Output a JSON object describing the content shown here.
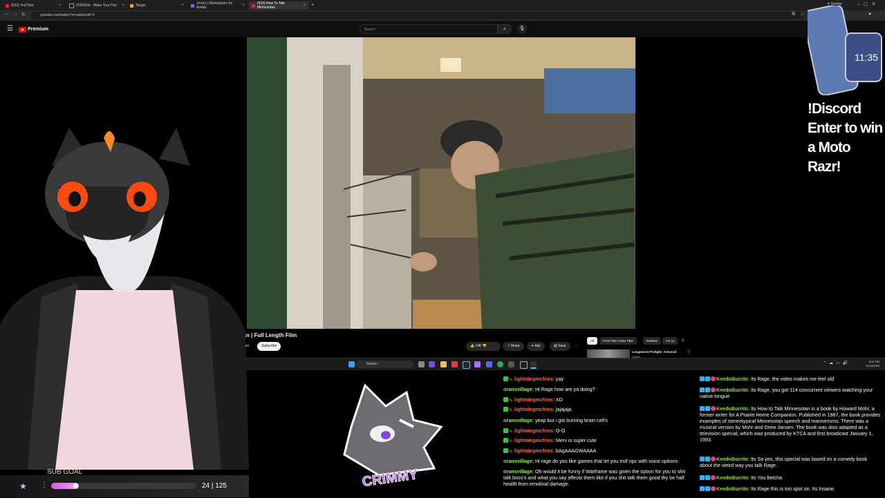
{
  "browser": {
    "tabs": [
      {
        "label": "(533) YouTube",
        "active": false
      },
      {
        "label": "(5354)ick - Make Your Day",
        "active": false
      },
      {
        "label": "Tangia",
        "active": false
      },
      {
        "label": "Jinxxy | Marketplace for Avatar",
        "active": false
      },
      {
        "label": "(533) How To Talk Minnesotan",
        "active": true
      }
    ],
    "new_tab": "+",
    "url": "youtube.com/watch?v=xuGeuvd4-0",
    "profile_label": "Gemini"
  },
  "youtube": {
    "brand": "Premium",
    "search_placeholder": "Search",
    "video_title": "esotan | Full Length Film",
    "join_label": "Join",
    "subscribe_label": "Subscribe",
    "like_count": "14K",
    "share_label": "Share",
    "ask_label": "Ask",
    "save_label": "Save",
    "more_label": "···",
    "chips": [
      "All",
      "From Twin Cities PBS",
      "Related",
      "For yo"
    ],
    "rec_title": "Longsword Profight: Armored",
    "rec_sub": "HEMA"
  },
  "taskbar": {
    "search_label": "Search",
    "time": "8:37 PM",
    "date": "12/16/2025"
  },
  "overlay": {
    "promo_lines": [
      "!Discord",
      "Enter to win",
      "a Moto Razr!"
    ],
    "phone_time": "11:35",
    "sub_goal_label": "SUB GOAL",
    "sub_goal_current": 24,
    "sub_goal_total": 125,
    "sub_goal_text": "24 | 125",
    "logo_text": "CRIMMY"
  },
  "chat_left": [
    {
      "user": "lightningmcfries",
      "color": "red",
      "badges": true,
      "text": "yay"
    },
    {
      "user": "oransvillage",
      "color": "green",
      "badges": false,
      "text": "Hi Rage how are ya doing?"
    },
    {
      "user": "lightningmcfries",
      "color": "red",
      "badges": true,
      "text": "XD"
    },
    {
      "user": "lightningmcfries",
      "color": "red",
      "badges": true,
      "text": "jajajaja"
    },
    {
      "user": "oransvillage",
      "color": "green",
      "badges": false,
      "text": "yeap but i got burning brain cell's"
    },
    {
      "user": "lightningmcfries",
      "color": "red",
      "badges": true,
      "text": "O-O"
    },
    {
      "user": "lightningmcfries",
      "color": "red",
      "badges": true,
      "text": "Merv is super cute"
    },
    {
      "user": "lightningmcfries",
      "color": "red",
      "badges": true,
      "text": "bAgAAAGWAAAA"
    },
    {
      "user": "oransvillage",
      "color": "green",
      "badges": false,
      "text": "Hi rage do you like games that let you troll npc with voice options"
    },
    {
      "user": "oransvillage",
      "color": "green",
      "badges": false,
      "text": "Oh would it be funny if Warframe was given the option for you to shit talk boss's and what you say affects them like if you shit talk them good thy be half health from emotinal damage."
    }
  ],
  "chat_right": [
    {
      "user": "KeedoBurrito",
      "text": "Its Rage, the video makes me feel old"
    },
    {
      "user": "KeedoBurrito",
      "text": "Its Rage, you got 114 concurrent viewers watching your native tongue"
    },
    {
      "user": "KeedoBurrito",
      "text": "Its How to Talk Minnesotan is a book by Howard Mohr, a former writer for A Prairie Home Companion. Published in 1987, the book provides examples of stereotypical Minnesotan speech and mannerisms. There was a musical version by Mohr and Drew Jansen. The book was also adapted as a television special, which was produced by KTCA and first broadcast January 1, 1993."
    },
    {
      "user": "KeedoBurrito",
      "text": "Its So yes, this special was based on a comedy book about the weird way you talk Rage."
    },
    {
      "user": "KeedoBurrito",
      "text": "Its You betcha"
    },
    {
      "user": "KeedoBurrito",
      "text": "Its Rage this is too spot on. Its Insane."
    }
  ],
  "colors": {
    "yt_red": "#ff0000",
    "chat_green": "#9be36b",
    "chat_red": "#ff6a3d",
    "chat_lime": "#9ed63f",
    "goal_pink": "#d75bd9"
  }
}
